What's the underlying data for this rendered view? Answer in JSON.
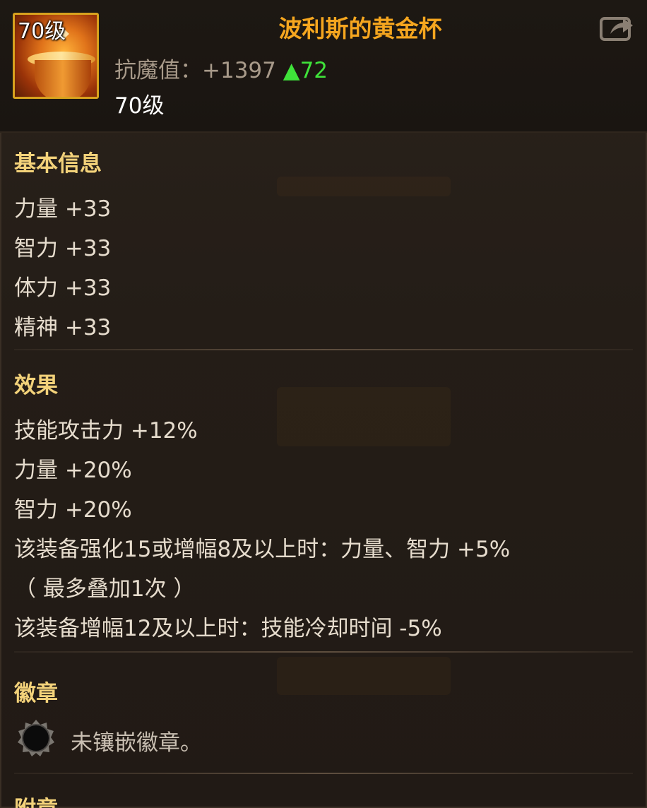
{
  "item": {
    "icon_level": "70级",
    "name": "波利斯的黄金杯",
    "resist_label": "抗魔值：",
    "resist_value": "+1397",
    "resist_delta": "▲72",
    "level": "70级",
    "share_icon": "share-icon"
  },
  "basic": {
    "title": "基本信息",
    "stats": [
      "力量 +33",
      "智力 +33",
      "体力 +33",
      "精神 +33"
    ]
  },
  "effects": {
    "title": "效果",
    "lines": [
      "技能攻击力 +12%",
      "力量 +20%",
      "智力 +20%",
      "该装备强化15或增幅8及以上时：力量、智力 +5%",
      "（ 最多叠加1次 ）",
      "该装备增幅12及以上时：技能冷却时间 -5%"
    ]
  },
  "emblem": {
    "title": "徽章",
    "empty_text": "未镶嵌徽章。",
    "icon": "emblem-socket-icon"
  },
  "next_section_title": "附章",
  "colors": {
    "title": "#f5a61f",
    "section": "#f3d27a",
    "delta": "#3fe23a",
    "text": "#e6dccd"
  }
}
